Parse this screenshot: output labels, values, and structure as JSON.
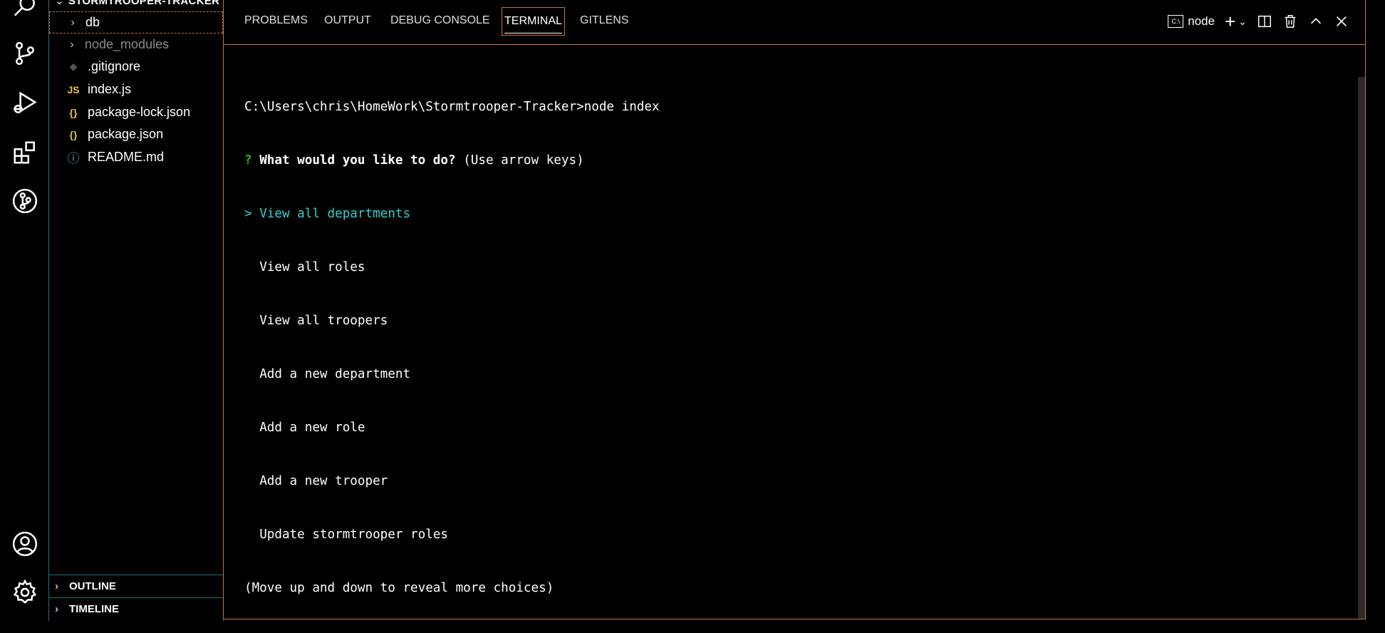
{
  "sidebar": {
    "explorer_title": "STORMTROOPER-TRACKER",
    "items": [
      {
        "label": "db",
        "kind": "folder",
        "icon": "chevron-right-icon"
      },
      {
        "label": "node_modules",
        "kind": "folder",
        "icon": "chevron-right-icon"
      },
      {
        "label": ".gitignore",
        "kind": "file",
        "icon": "git-icon"
      },
      {
        "label": "index.js",
        "kind": "file",
        "icon": "js-icon",
        "icon_text": "JS"
      },
      {
        "label": "package-lock.json",
        "kind": "file",
        "icon": "json-icon",
        "icon_text": "{}"
      },
      {
        "label": "package.json",
        "kind": "file",
        "icon": "json-icon",
        "icon_text": "{}"
      },
      {
        "label": "README.md",
        "kind": "file",
        "icon": "info-icon",
        "icon_text": "ⓘ"
      }
    ],
    "sections": {
      "outline": "OUTLINE",
      "timeline": "TIMELINE"
    }
  },
  "activity_bar": [
    "search-icon",
    "source-control-icon",
    "run-debug-icon",
    "extensions-icon",
    "gitlens-icon",
    "account-icon",
    "settings-gear-icon"
  ],
  "panel": {
    "tabs": [
      "PROBLEMS",
      "OUTPUT",
      "DEBUG CONSOLE",
      "TERMINAL",
      "GITLENS"
    ],
    "active_tab": "TERMINAL",
    "terminal_name": "node"
  },
  "terminal": {
    "command_line": "C:\\Users\\chris\\HomeWork\\Stormtrooper-Tracker>node index",
    "prompt_mark": "?",
    "question": "What would you like to do?",
    "hint": "(Use arrow keys)",
    "pointer": ">",
    "choices": [
      "View all departments",
      "View all roles",
      "View all troopers",
      "Add a new department",
      "Add a new role",
      "Add a new trooper",
      "Update stormtrooper roles"
    ],
    "selected_index": 0,
    "footer": "(Move up and down to reveal more choices)"
  },
  "colors": {
    "border_accent": "#c8743a",
    "sidebar_border": "#2a6c7c",
    "prompt_green": "#19c020",
    "selected_cyan": "#2fd0d0",
    "json_icon": "#e5c04a",
    "js_icon": "#e5c04a",
    "info_icon": "#6aa8d8"
  }
}
